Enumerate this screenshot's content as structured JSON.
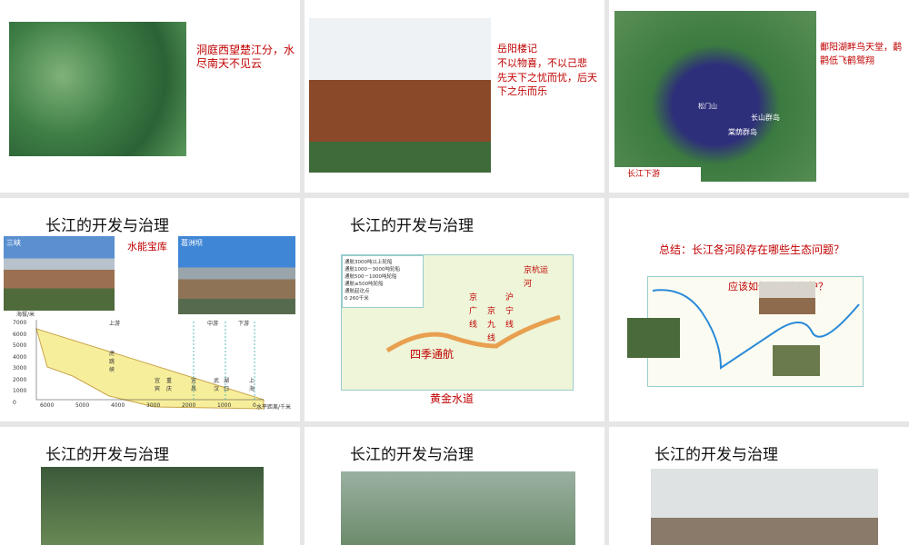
{
  "slides": [
    {
      "bullet": "洞庭西望楚江分，水尽南天不见云"
    },
    {
      "title": "岳阳楼记",
      "lines": [
        "不以物喜，不以己悲",
        "先天下之忧而忧，后天下之乐而乐"
      ]
    },
    {
      "text": "鄱阳湖畔鸟天堂，鹬鹳低飞鹤鹭翔",
      "bullet": "长江下游",
      "map_labels": [
        "长山群岛",
        "棠荫群岛",
        "松门山"
      ]
    },
    {
      "title": "长江的开发与治理",
      "bullet": "水能宝库",
      "photo1": "三峡",
      "photo2": "葛洲坝",
      "chart": {
        "ylabel": "海拔/米",
        "xlabel": "水平距离/千米",
        "yticks": [
          "7000",
          "6000",
          "5000",
          "4000",
          "3000",
          "2000",
          "1000",
          "0"
        ],
        "xticks": [
          "6000",
          "5000",
          "4000",
          "3000",
          "2000",
          "1000",
          "0"
        ],
        "sections": [
          "上游",
          "中游",
          "下游"
        ],
        "places": [
          "虎跳峡",
          "宜宾",
          "重庆",
          "宜昌",
          "武汉",
          "湖口",
          "上海"
        ]
      }
    },
    {
      "title": "长江的开发与治理",
      "legend": [
        "通航3000吨以上轮船",
        "通航1000－3000吨轮船",
        "通航500－1000吨轮船",
        "通航≤500吨轮船",
        "通航起讫点"
      ],
      "scale": "0   260千米",
      "labels": [
        "京广线",
        "京九线",
        "沪宁线",
        "京杭运河",
        "四季通航"
      ],
      "caption": "黄金水道"
    },
    {
      "title": "总结：长江各河段存在哪些生态问题？",
      "subtitle": "应该如何治理和保护？"
    },
    {
      "title": "长江的开发与治理"
    },
    {
      "title": "长江的开发与治理"
    },
    {
      "title": "长江的开发与治理"
    }
  ]
}
